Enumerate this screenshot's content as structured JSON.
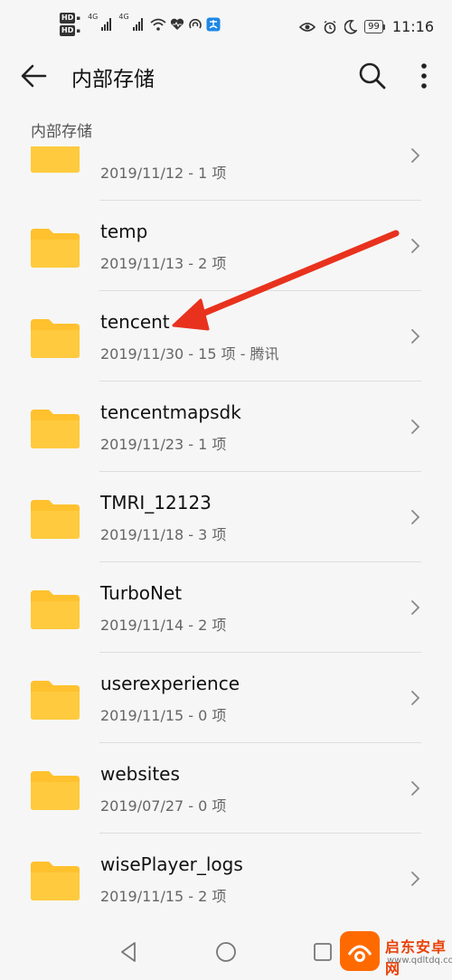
{
  "status_bar": {
    "hd_label": "HD",
    "net_label": "4G",
    "battery": "99",
    "time": "11:16"
  },
  "header": {
    "title": "内部存储"
  },
  "breadcrumb": "内部存储",
  "folders": [
    {
      "name": "",
      "meta": "2019/11/12 - 1 项"
    },
    {
      "name": "temp",
      "meta": "2019/11/13 - 2 项"
    },
    {
      "name": "tencent",
      "meta": "2019/11/30 - 15 项 - 腾讯"
    },
    {
      "name": "tencentmapsdk",
      "meta": "2019/11/23 - 1 项"
    },
    {
      "name": "TMRI_12123",
      "meta": "2019/11/18 - 3 项"
    },
    {
      "name": "TurboNet",
      "meta": "2019/11/14 - 2 项"
    },
    {
      "name": "userexperience",
      "meta": "2019/11/15 - 0 项"
    },
    {
      "name": "websites",
      "meta": "2019/07/27 - 0 项"
    },
    {
      "name": "wisePlayer_logs",
      "meta": "2019/11/15 - 2 项"
    }
  ],
  "icons": {
    "back": "arrow-left-icon",
    "search": "search-icon",
    "more": "more-vertical-icon",
    "folder": "folder-icon",
    "chevron": "chevron-right-icon"
  },
  "colors": {
    "folder": "#ffc12e",
    "folder_tab": "#ffd45a",
    "annotation_arrow": "#e8321e",
    "background": "#f6f6f6"
  },
  "watermark": {
    "title": "启东安卓网",
    "url": "www.qdltdq.com"
  }
}
